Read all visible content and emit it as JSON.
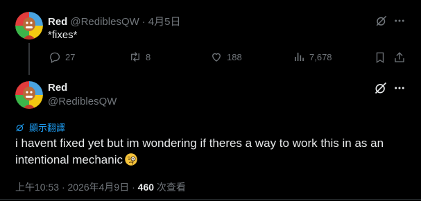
{
  "reply_tweet": {
    "display_name": "Red",
    "handle": "@RediblesQW",
    "separator": "·",
    "date": "4月5日",
    "text": "*fixes*",
    "replies": "27",
    "retweets": "8",
    "likes": "188",
    "views": "7,678"
  },
  "main_tweet": {
    "display_name": "Red",
    "handle": "@RediblesQW",
    "translate_label": "顯示翻譯",
    "text": "i havent fixed yet but im wondering if theres a way to work this in as an intentional mechanic",
    "emoji": "face-with-monocle",
    "time": "上午10:53",
    "separator": "·",
    "date": "2026年4月9日",
    "views_count": "460",
    "views_label": "次查看"
  },
  "colors": {
    "background": "#000000",
    "text": "#e7e9ea",
    "muted": "#71767b",
    "link": "#1d9bf0",
    "divider": "#2f3336"
  },
  "icons": [
    "avatar",
    "grok-icon",
    "more-icon",
    "reply-icon",
    "retweet-icon",
    "like-icon",
    "views-icon",
    "bookmark-icon",
    "translate-icon",
    "monocle-emoji"
  ]
}
